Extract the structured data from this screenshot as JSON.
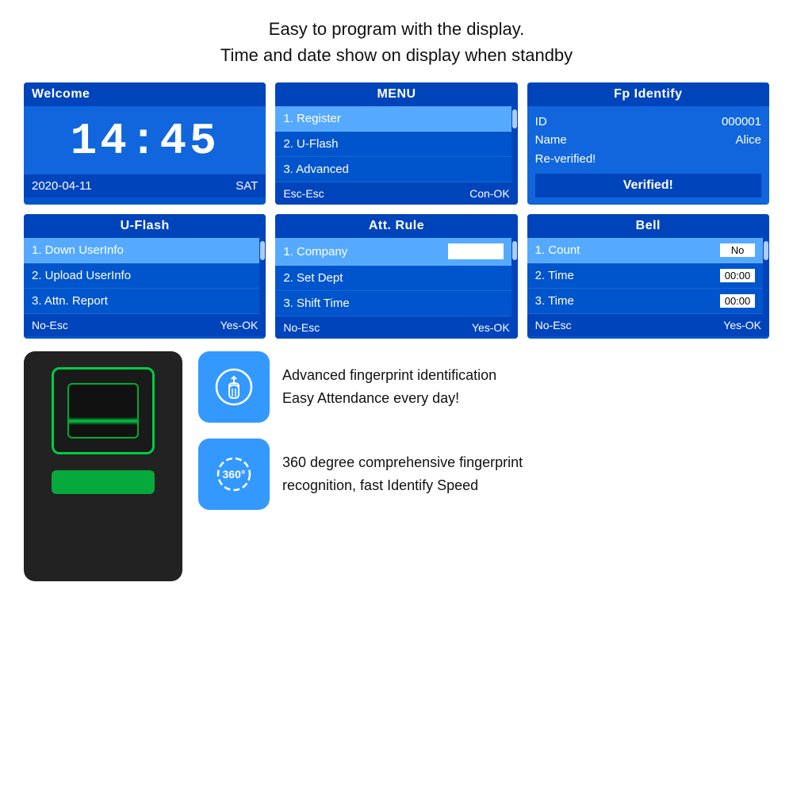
{
  "header": {
    "line1": "Easy to program with the display.",
    "line2": "Time and date show on display when standby"
  },
  "screens": {
    "welcome": {
      "title": "Welcome",
      "clock": "14:45",
      "date": "2020-04-11",
      "day": "SAT"
    },
    "menu": {
      "title": "MENU",
      "items": [
        {
          "label": "1. Register",
          "selected": true
        },
        {
          "label": "2. U-Flash",
          "selected": false
        },
        {
          "label": "3. Advanced",
          "selected": false
        }
      ],
      "footer_esc": "Esc-Esc",
      "footer_ok": "Con-OK"
    },
    "fp_identify": {
      "title": "Fp Identify",
      "id_label": "ID",
      "id_value": "000001",
      "name_label": "Name",
      "name_value": "Alice",
      "reverify": "Re-verified!",
      "verified": "Verified!"
    },
    "uflash": {
      "title": "U-Flash",
      "items": [
        {
          "label": "1. Down UserInfo",
          "selected": true
        },
        {
          "label": "2. Upload UserInfo",
          "selected": false
        },
        {
          "label": "3. Attn. Report",
          "selected": false
        }
      ],
      "footer_esc": "No-Esc",
      "footer_ok": "Yes-OK"
    },
    "att_rule": {
      "title": "Att. Rule",
      "items": [
        {
          "label": "1. Company",
          "selected": true,
          "has_input": true
        },
        {
          "label": "2. Set Dept",
          "selected": false,
          "has_input": false
        },
        {
          "label": "3. Shift Time",
          "selected": false,
          "has_input": false
        }
      ],
      "footer_esc": "No-Esc",
      "footer_ok": "Yes-OK"
    },
    "bell": {
      "title": "Bell",
      "items": [
        {
          "label": "1. Count",
          "value": "No",
          "selected": true
        },
        {
          "label": "2. Time",
          "value": "00:00",
          "selected": false
        },
        {
          "label": "3. Time",
          "value": "00:00",
          "selected": false
        }
      ],
      "footer_esc": "No-Esc",
      "footer_ok": "Yes-OK"
    }
  },
  "features": [
    {
      "icon": "✋",
      "text_line1": "Advanced fingerprint identification",
      "text_line2": "Easy Attendance every day!"
    },
    {
      "icon": "360°",
      "text_line1": "360 degree comprehensive fingerprint",
      "text_line2": "recognition, fast Identify Speed"
    }
  ]
}
